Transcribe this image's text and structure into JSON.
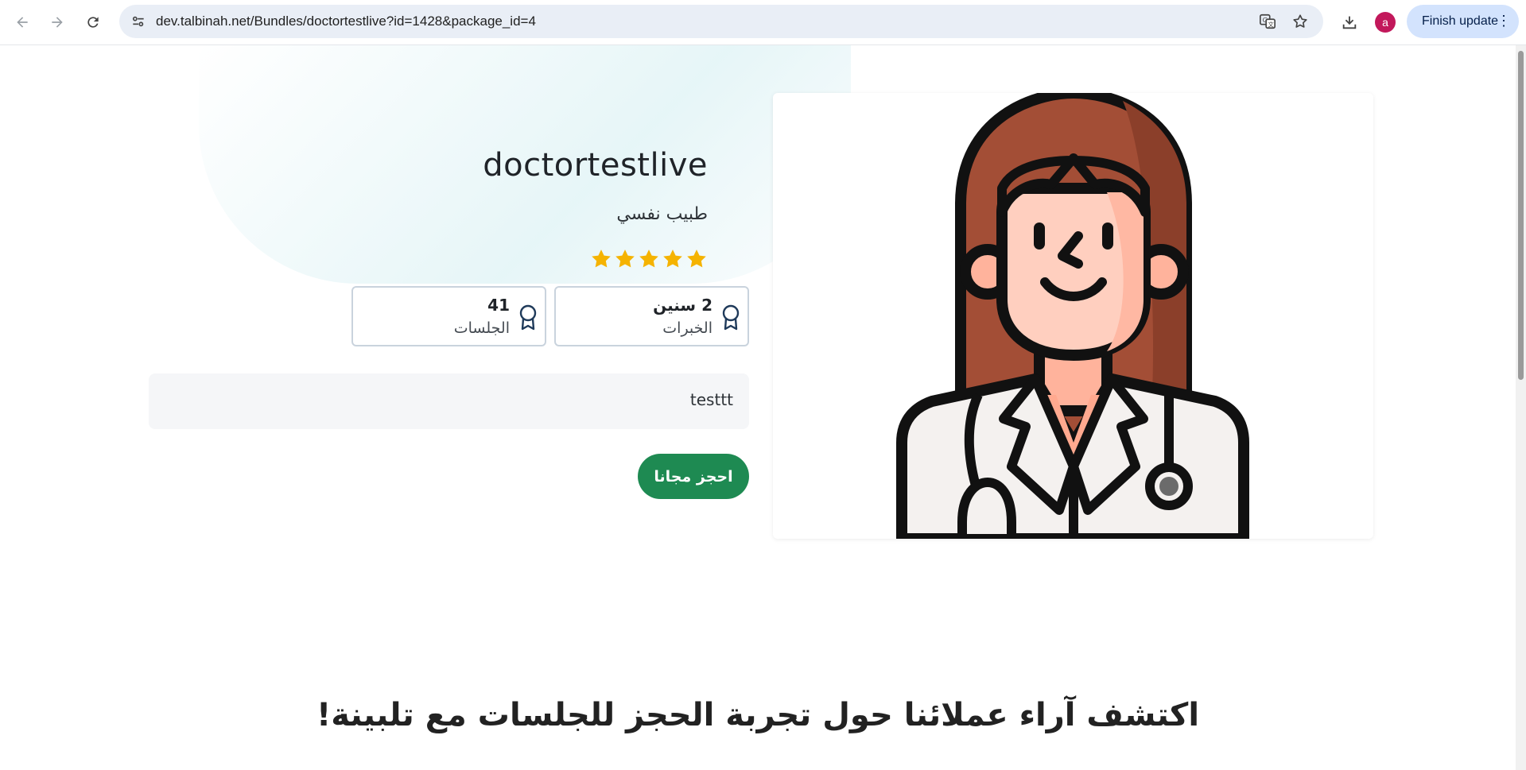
{
  "browser": {
    "url": "dev.talbinah.net/Bundles/doctortestlive?id=1428&package_id=4",
    "profile_initial": "a",
    "finish_update_label": "Finish update",
    "icons": [
      "back-icon",
      "forward-icon",
      "reload-icon",
      "site-settings-icon",
      "translate-icon",
      "bookmark-star-icon",
      "download-icon",
      "more-vert-icon"
    ]
  },
  "doctor": {
    "name": "doctortestlive",
    "title": "طبيب نفسي",
    "rating": 5,
    "rating_max": 5,
    "star_color": "#f5b301"
  },
  "stats": [
    {
      "value": "2 سنين",
      "label": "الخبرات"
    },
    {
      "value": "41",
      "label": "الجلسات"
    }
  ],
  "bio": "testtt",
  "book_button_label": "احجز مجانا",
  "reviews_heading": "اكتشف آراء عملائنا حول تجربة الحجز للجلسات مع تلبينة!",
  "colors": {
    "accent_green": "#1e8a52",
    "hair": "#9c4a33",
    "skin": "#ffcfbf",
    "coat": "#f4f1ef"
  }
}
